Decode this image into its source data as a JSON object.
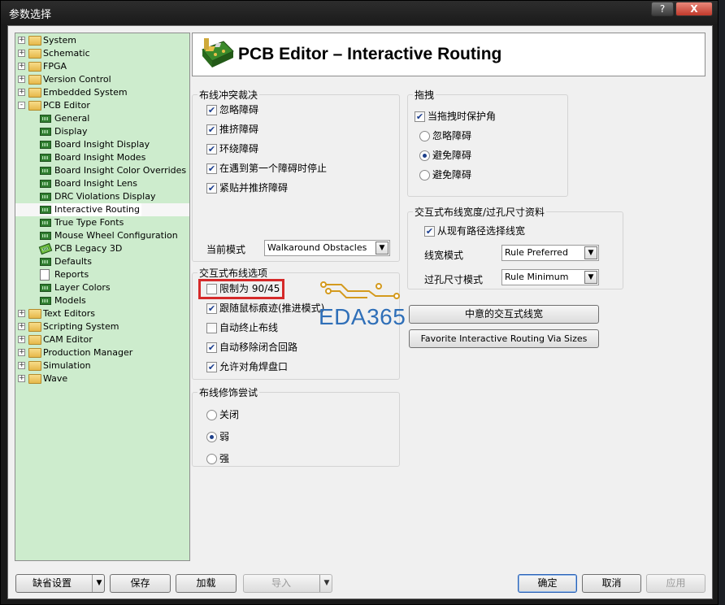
{
  "window": {
    "title": "参数选择",
    "help": "?",
    "close": "X"
  },
  "tree": {
    "items": [
      {
        "label": "System",
        "icon": "folder-icon",
        "expander": "+"
      },
      {
        "label": "Schematic",
        "icon": "folder-icon",
        "expander": "+"
      },
      {
        "label": "FPGA",
        "icon": "folder-icon",
        "expander": "+"
      },
      {
        "label": "Version Control",
        "icon": "folder-icon",
        "expander": "+"
      },
      {
        "label": "Embedded System",
        "icon": "folder-icon",
        "expander": "+"
      },
      {
        "label": "PCB Editor",
        "icon": "folder-icon",
        "expander": "-"
      },
      {
        "label": "General",
        "icon": "chip-icon"
      },
      {
        "label": "Display",
        "icon": "chip-icon"
      },
      {
        "label": "Board Insight Display",
        "icon": "chip-icon"
      },
      {
        "label": "Board Insight Modes",
        "icon": "chip-icon"
      },
      {
        "label": "Board Insight Color Overrides",
        "icon": "chip-icon"
      },
      {
        "label": "Board Insight Lens",
        "icon": "chip-icon"
      },
      {
        "label": "DRC Violations Display",
        "icon": "chip-icon"
      },
      {
        "label": "Interactive Routing",
        "icon": "chip-icon",
        "selected": true
      },
      {
        "label": "True Type Fonts",
        "icon": "chip-icon"
      },
      {
        "label": "Mouse Wheel Configuration",
        "icon": "chip-icon"
      },
      {
        "label": "PCB Legacy 3D",
        "icon": "legacy-3d-icon"
      },
      {
        "label": "Defaults",
        "icon": "chip-icon"
      },
      {
        "label": "Reports",
        "icon": "document-icon"
      },
      {
        "label": "Layer Colors",
        "icon": "chip-icon"
      },
      {
        "label": "Models",
        "icon": "chip-icon"
      },
      {
        "label": "Text Editors",
        "icon": "folder-icon",
        "expander": "+"
      },
      {
        "label": "Scripting System",
        "icon": "folder-icon",
        "expander": "+"
      },
      {
        "label": "CAM Editor",
        "icon": "folder-icon",
        "expander": "+"
      },
      {
        "label": "Production Manager",
        "icon": "folder-icon",
        "expander": "+"
      },
      {
        "label": "Simulation",
        "icon": "folder-icon",
        "expander": "+"
      },
      {
        "label": "Wave",
        "icon": "folder-icon",
        "expander": "+"
      }
    ]
  },
  "header": {
    "title": "PCB Editor – Interactive Routing",
    "icon": "pcb-board-icon"
  },
  "conflict": {
    "title": "布线冲突裁决",
    "options": [
      {
        "label": "忽略障碍",
        "checked": true
      },
      {
        "label": "推挤障碍",
        "checked": true
      },
      {
        "label": "环绕障碍",
        "checked": true
      },
      {
        "label": "在遇到第一个障碍时停止",
        "checked": true
      },
      {
        "label": "紧贴并推挤障碍",
        "checked": true
      }
    ],
    "current_mode_label": "当前模式",
    "current_mode_value": "Walkaround Obstacles"
  },
  "drag": {
    "title": "拖拽",
    "preserve_angle": {
      "label": "当拖拽时保护角",
      "checked": true
    },
    "radios": [
      {
        "label": "忽略障碍",
        "selected": false
      },
      {
        "label": "避免障碍",
        "selected": true
      },
      {
        "label": "避免障碍",
        "selected": false
      }
    ]
  },
  "width_via": {
    "title": "交互式布线宽度/过孔尺寸资料",
    "pickup": {
      "label": "从现有路径选择线宽",
      "checked": true
    },
    "width_mode_label": "线宽模式",
    "width_mode_value": "Rule Preferred",
    "via_mode_label": "过孔尺寸模式",
    "via_mode_value": "Rule Minimum",
    "fav_width_button": "中意的交互式线宽",
    "fav_via_button": "Favorite Interactive Routing Via Sizes"
  },
  "routing_options": {
    "title": "交互式布线选项",
    "options": [
      {
        "label": "限制为 90/45",
        "checked": false
      },
      {
        "label": "跟随鼠标痕迹(推进模式)",
        "checked": true
      },
      {
        "label": "自动终止布线",
        "checked": false
      },
      {
        "label": "自动移除闭合回路",
        "checked": true
      },
      {
        "label": "允许对角焊盘口",
        "checked": true
      }
    ]
  },
  "gloss": {
    "title": "布线修饰尝试",
    "radios": [
      {
        "label": "关闭",
        "selected": false
      },
      {
        "label": "弱",
        "selected": true
      },
      {
        "label": "强",
        "selected": false
      }
    ]
  },
  "watermark": {
    "text": "EDA365"
  },
  "footer": {
    "defaults": "缺省设置",
    "save": "保存",
    "load": "加载",
    "import": "导入",
    "ok": "确定",
    "cancel": "取消",
    "apply": "应用"
  },
  "colors": {
    "tree_bg": "#cdeccd",
    "highlight": "#d52a2a",
    "watermark": "#2f6fb8"
  }
}
